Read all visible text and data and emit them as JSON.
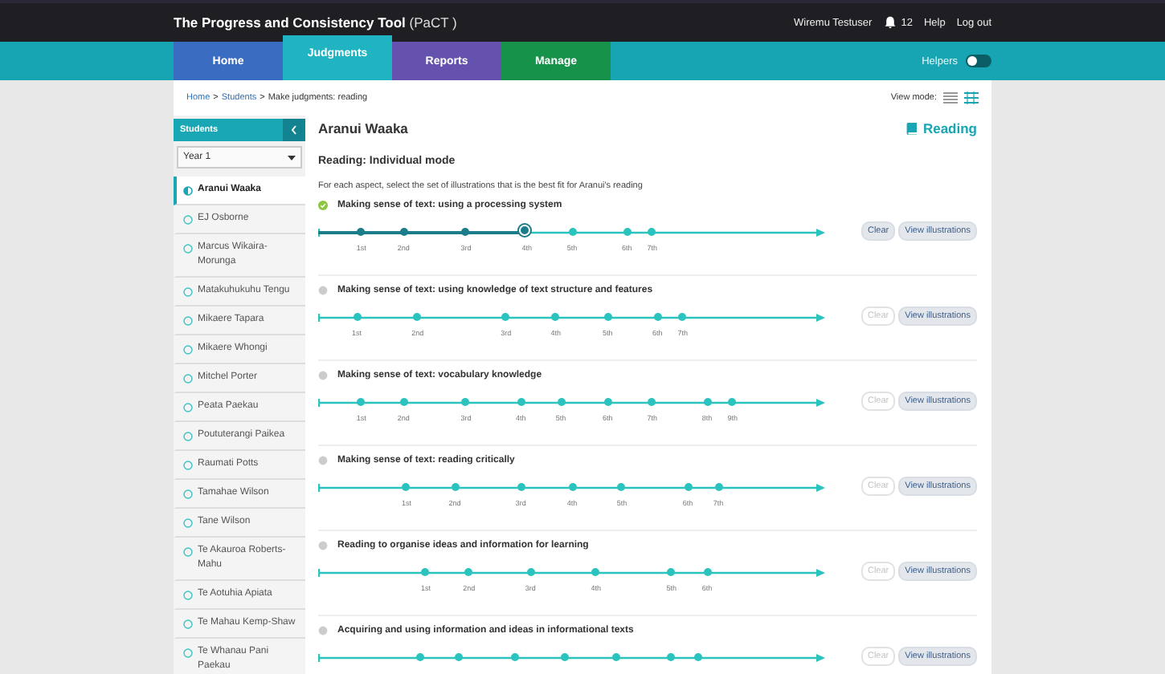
{
  "header": {
    "title": "**The Progress and Consistency Tool** (PaCT )",
    "user": "Wiremu Testuser",
    "notifications": "12",
    "links": [
      "Help",
      "Log out"
    ]
  },
  "nav": {
    "tabs": [
      {
        "label": "Home",
        "selected": false,
        "color": "#3a6cc2"
      },
      {
        "label": "Judgments",
        "selected": true,
        "color": "#20b3c2"
      },
      {
        "label": "Reports",
        "selected": false,
        "color": "#6552ae"
      },
      {
        "label": "Manage",
        "selected": false,
        "color": "#17924a"
      }
    ],
    "helpers": {
      "label": "Helpers",
      "on": false
    }
  },
  "breadcrumb": [
    {
      "kind": "link",
      "text": "Home"
    },
    {
      "kind": "sep",
      "text": ">"
    },
    {
      "kind": "link",
      "text": "Students"
    },
    {
      "kind": "sep",
      "text": ">"
    },
    {
      "kind": "text",
      "text": "Make judgments: reading"
    }
  ],
  "view_mode": {
    "label": "View mode:",
    "modes": [
      {
        "kind": "list",
        "selected": false
      },
      {
        "kind": "detail",
        "selected": true
      }
    ]
  },
  "sidebar": {
    "title": "Students",
    "year": "Year 1",
    "students": [
      {
        "name": "Aranui Waaka",
        "selected": true
      },
      {
        "name": "EJ Osborne",
        "selected": false
      },
      {
        "name": "Marcus Wikaira-Morunga",
        "selected": false
      },
      {
        "name": "Matakuhukuhu Tengu",
        "selected": false
      },
      {
        "name": "Mikaere Tapara",
        "selected": false
      },
      {
        "name": "Mikaere Whongi",
        "selected": false
      },
      {
        "name": "Mitchel Porter",
        "selected": false
      },
      {
        "name": "Peata Paekau",
        "selected": false
      },
      {
        "name": "Poututerangi Paikea",
        "selected": false
      },
      {
        "name": "Raumati Potts",
        "selected": false
      },
      {
        "name": "Tamahae Wilson",
        "selected": false
      },
      {
        "name": "Tane Wilson",
        "selected": false
      },
      {
        "name": "Te Akauroa Roberts-Mahu",
        "selected": false
      },
      {
        "name": "Te Aotuhia Apiata",
        "selected": false
      },
      {
        "name": "Te Mahau Kemp-Shaw",
        "selected": false
      },
      {
        "name": "Te Whanau Pani Paekau",
        "selected": false
      }
    ]
  },
  "main": {
    "student": "Aranui Waaka",
    "subject": "Reading",
    "mode": "Reading: Individual mode",
    "instruction": "For each aspect, select the set of illustrations that is the best fit for Aranui's reading",
    "aspects": [
      {
        "title": "Making sense of text: using a processing system",
        "done": true,
        "clear": "Clear",
        "view": "View illustrations",
        "points": [
          {
            "label": "1st",
            "selected": false
          },
          {
            "label": "2nd",
            "selected": false
          },
          {
            "label": "3rd",
            "selected": false
          },
          {
            "label": "4th",
            "selected": true
          },
          {
            "label": "5th",
            "selected": false
          },
          {
            "label": "6th",
            "selected": false
          },
          {
            "label": "7th",
            "selected": false
          }
        ]
      },
      {
        "title": "Making sense of text: using knowledge of text structure and features",
        "done": false,
        "clear": "Clear",
        "view": "View illustrations",
        "points": [
          {
            "label": "1st",
            "selected": false
          },
          {
            "label": "2nd",
            "selected": false
          },
          {
            "label": "3rd",
            "selected": false
          },
          {
            "label": "4th",
            "selected": false
          },
          {
            "label": "5th",
            "selected": false
          },
          {
            "label": "6th",
            "selected": false
          },
          {
            "label": "7th",
            "selected": false
          }
        ]
      },
      {
        "title": "Making sense of text: vocabulary knowledge",
        "done": false,
        "clear": "Clear",
        "view": "View illustrations",
        "points": [
          {
            "label": "1st",
            "selected": false
          },
          {
            "label": "2nd",
            "selected": false
          },
          {
            "label": "3rd",
            "selected": false
          },
          {
            "label": "4th",
            "selected": false
          },
          {
            "label": "5th",
            "selected": false
          },
          {
            "label": "6th",
            "selected": false
          },
          {
            "label": "7th",
            "selected": false
          },
          {
            "label": "8th",
            "selected": false
          },
          {
            "label": "9th",
            "selected": false
          }
        ]
      },
      {
        "title": "Making sense of text: reading critically",
        "done": false,
        "clear": "Clear",
        "view": "View illustrations",
        "points": [
          {
            "label": "1st",
            "selected": false
          },
          {
            "label": "2nd",
            "selected": false
          },
          {
            "label": "3rd",
            "selected": false
          },
          {
            "label": "4th",
            "selected": false
          },
          {
            "label": "5th",
            "selected": false
          },
          {
            "label": "6th",
            "selected": false
          },
          {
            "label": "7th",
            "selected": false
          }
        ]
      },
      {
        "title": "Reading to organise ideas and information for learning",
        "done": false,
        "clear": "Clear",
        "view": "View illustrations",
        "points": [
          {
            "label": "1st",
            "selected": false
          },
          {
            "label": "2nd",
            "selected": false
          },
          {
            "label": "3rd",
            "selected": false
          },
          {
            "label": "4th",
            "selected": false
          },
          {
            "label": "5th",
            "selected": false
          },
          {
            "label": "6th",
            "selected": false
          }
        ]
      },
      {
        "title": "Acquiring and using information and ideas in informational texts",
        "done": false,
        "clear": "Clear",
        "view": "View illustrations",
        "points": [
          {
            "selected": false
          },
          {
            "selected": false
          },
          {
            "selected": false
          },
          {
            "selected": false
          },
          {
            "selected": false
          },
          {
            "selected": false
          },
          {
            "selected": false
          }
        ]
      }
    ]
  }
}
